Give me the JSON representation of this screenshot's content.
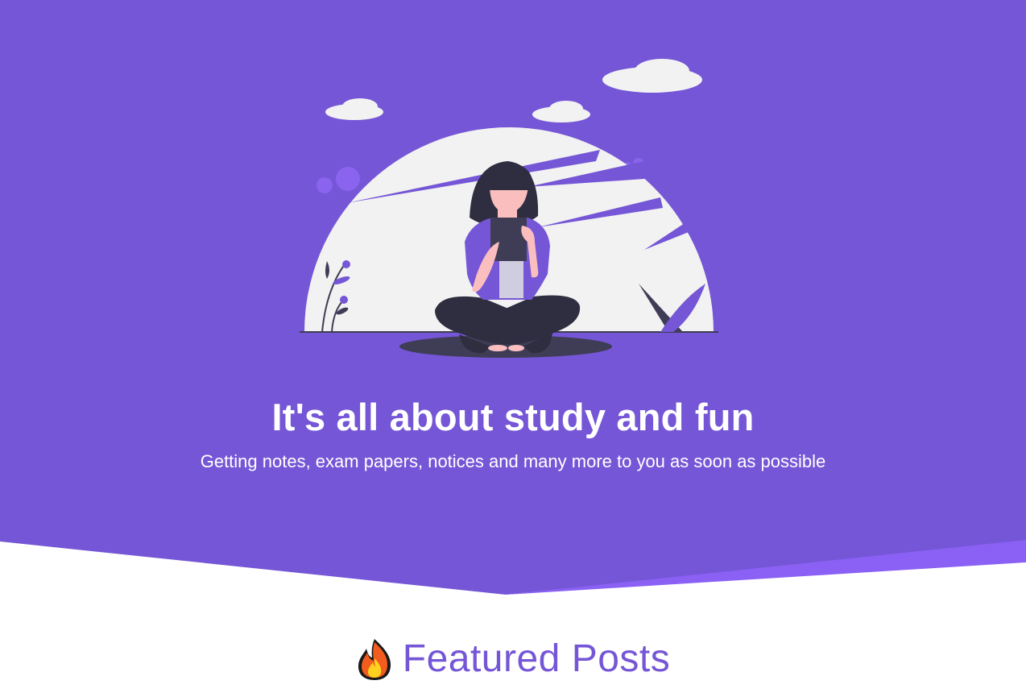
{
  "hero": {
    "title": "It's all about study and fun",
    "subtitle": "Getting notes, exam papers, notices and many more to you as soon as possible",
    "illustration_icon": "woman-reading-illustration"
  },
  "featured": {
    "icon": "fire-icon",
    "title": "Featured Posts"
  },
  "colors": {
    "primary": "#7556d6",
    "accent": "#8a60f5",
    "heading": "#7556d6",
    "text_on_primary": "#ffffff"
  }
}
